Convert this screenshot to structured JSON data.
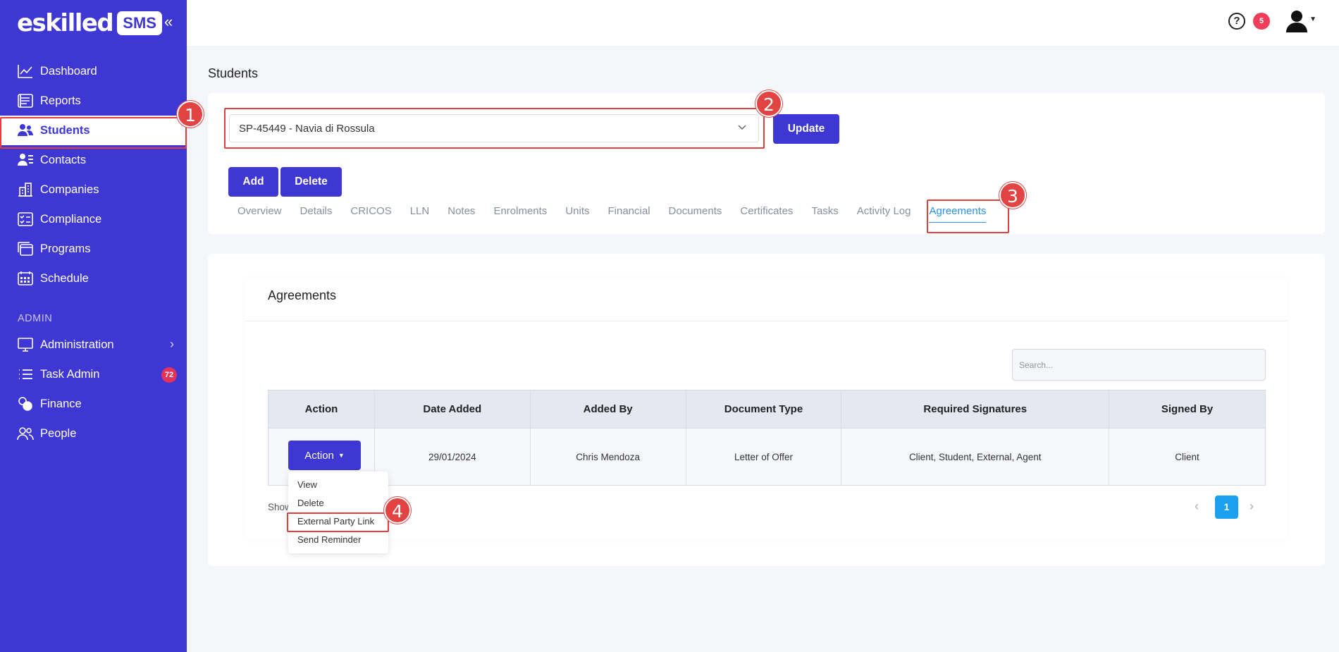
{
  "brand": {
    "logo_text": "eskilled",
    "logo_badge": "SMS"
  },
  "sidebar": {
    "items": [
      {
        "label": "Dashboard",
        "icon": "chart-line-icon"
      },
      {
        "label": "Reports",
        "icon": "reports-icon"
      },
      {
        "label": "Students",
        "icon": "users-icon",
        "active": true
      },
      {
        "label": "Contacts",
        "icon": "contacts-icon"
      },
      {
        "label": "Companies",
        "icon": "building-icon"
      },
      {
        "label": "Compliance",
        "icon": "checklist-icon"
      },
      {
        "label": "Programs",
        "icon": "programs-icon"
      },
      {
        "label": "Schedule",
        "icon": "calendar-icon"
      }
    ],
    "admin_section_label": "ADMIN",
    "admin_items": [
      {
        "label": "Administration",
        "icon": "monitor-icon"
      },
      {
        "label": "Task Admin",
        "icon": "list-icon",
        "badge": "72"
      },
      {
        "label": "Finance",
        "icon": "coins-icon"
      },
      {
        "label": "People",
        "icon": "people-icon"
      }
    ]
  },
  "topbar": {
    "help_badge": "5"
  },
  "page": {
    "title": "Students",
    "student_select_value": "SP-45449 - Navia di Rossula",
    "update_label": "Update",
    "add_label": "Add",
    "delete_label": "Delete",
    "tabs": [
      "Overview",
      "Details",
      "CRICOS",
      "LLN",
      "Notes",
      "Enrolments",
      "Units",
      "Financial",
      "Documents",
      "Certificates",
      "Tasks",
      "Activity Log",
      "Agreements"
    ],
    "active_tab": "Agreements"
  },
  "agreements": {
    "title": "Agreements",
    "search_placeholder": "Search...",
    "columns": [
      "Action",
      "Date Added",
      "Added By",
      "Document Type",
      "Required Signatures",
      "Signed By"
    ],
    "rows": [
      {
        "action_label": "Action",
        "date_added": "29/01/2024",
        "added_by": "Chris Mendoza",
        "document_type": "Letter of Offer",
        "required_signatures": "Client, Student, External, Agent",
        "signed_by": "Client"
      }
    ],
    "action_menu": [
      "View",
      "Delete",
      "External Party Link",
      "Send Reminder"
    ],
    "showing_text": "Show",
    "current_page": "1"
  },
  "annotations": [
    "1",
    "2",
    "3",
    "4"
  ],
  "colors": {
    "primary": "#3f37d3",
    "highlight": "#e0403f",
    "link": "#2a8ff0",
    "page_active": "#1aa0ee"
  }
}
